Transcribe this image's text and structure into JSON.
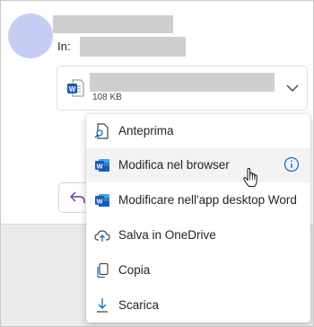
{
  "message": {
    "to_label": "In:",
    "attachment": {
      "size": "108 KB",
      "type_icon": "word-document-icon"
    }
  },
  "menu": {
    "items": [
      {
        "label": "Anteprima",
        "icon": "preview-icon"
      },
      {
        "label": "Modifica nel browser",
        "icon": "word-icon"
      },
      {
        "label": "Modificare nell'app desktop Word",
        "icon": "word-icon"
      },
      {
        "label": "Salva in OneDrive",
        "icon": "cloud-upload-icon"
      },
      {
        "label": "Copia",
        "icon": "copy-icon"
      },
      {
        "label": "Scarica",
        "icon": "download-icon"
      }
    ]
  },
  "colors": {
    "word_blue": "#185abd",
    "accent_blue": "#0f6cbd",
    "avatar": "#c6cdf5",
    "redaction": "#cfcfcf"
  }
}
